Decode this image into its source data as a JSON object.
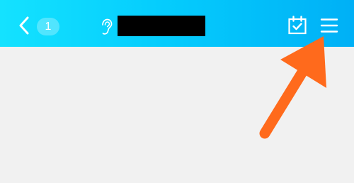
{
  "header": {
    "back_icon": "chevron-left-icon",
    "unread_count": "1",
    "ear_icon": "ear-icon",
    "calendar_icon": "calendar-check-icon",
    "menu_icon": "hamburger-menu-icon",
    "gradient_start": "#14e2ff",
    "gradient_end": "#00b0f6"
  },
  "content": {
    "background": "#f1f1f1"
  },
  "annotation": {
    "arrow_color": "#ff6a1c",
    "arrow_target": "hamburger-menu-icon"
  }
}
